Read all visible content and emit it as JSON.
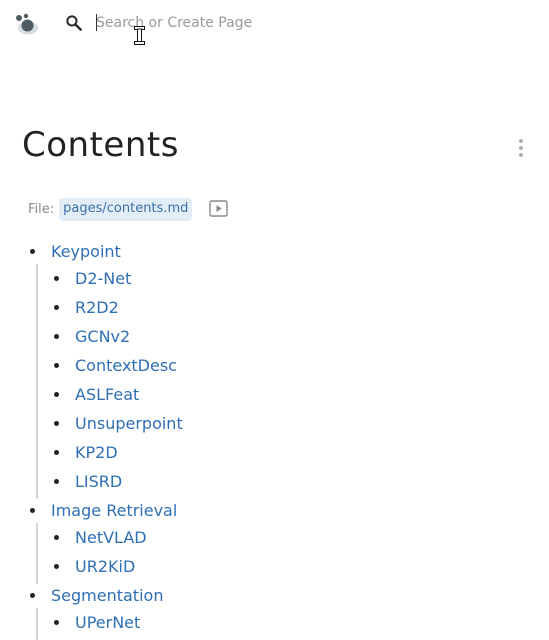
{
  "header": {
    "logo_icon": "dots-logo-icon",
    "search_icon": "search-icon",
    "search_placeholder": "Search or Create Page",
    "search_value": ""
  },
  "page": {
    "title": "Contents",
    "file_label": "File:",
    "file_path": "pages/contents.md",
    "menu_icon": "kebab-menu-icon",
    "present_icon": "play-present-icon"
  },
  "colors": {
    "link": "#2e6fb5",
    "file_path_bg": "#e3edf6",
    "file_path_text": "#3a6fa8",
    "guide_line": "#d4d4d4"
  },
  "tree": [
    {
      "label": "Keypoint",
      "children": [
        "D2-Net",
        "R2D2",
        "GCNv2",
        "ContextDesc",
        "ASLFeat",
        "Unsuperpoint",
        "KP2D",
        "LISRD"
      ]
    },
    {
      "label": "Image Retrieval",
      "children": [
        "NetVLAD",
        "UR2KiD"
      ]
    },
    {
      "label": "Segmentation",
      "children": [
        "UPerNet"
      ]
    }
  ]
}
